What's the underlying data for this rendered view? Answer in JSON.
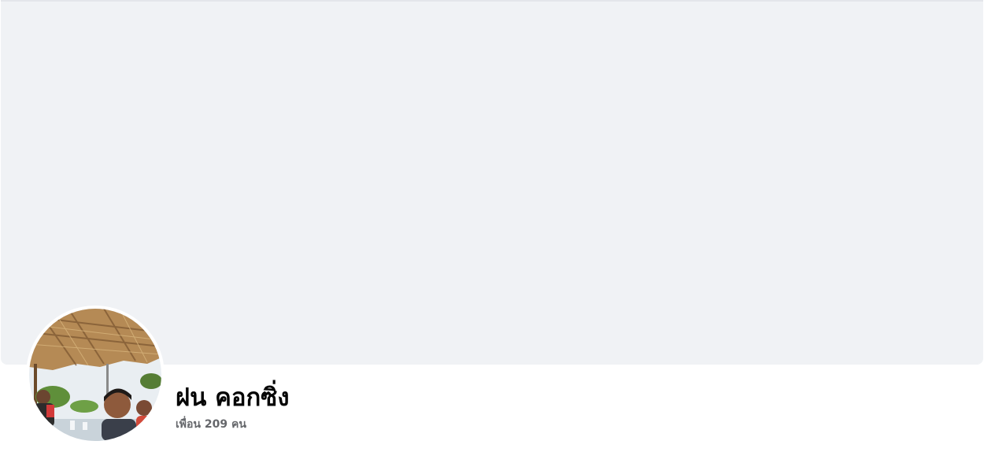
{
  "profile": {
    "name": "ฝน คอกซิ่ง",
    "friends_count": "เพื่อน 209 คน"
  },
  "colors": {
    "cover_background": "#f0f2f5",
    "name_text": "#050505",
    "secondary_text": "#65676b"
  }
}
